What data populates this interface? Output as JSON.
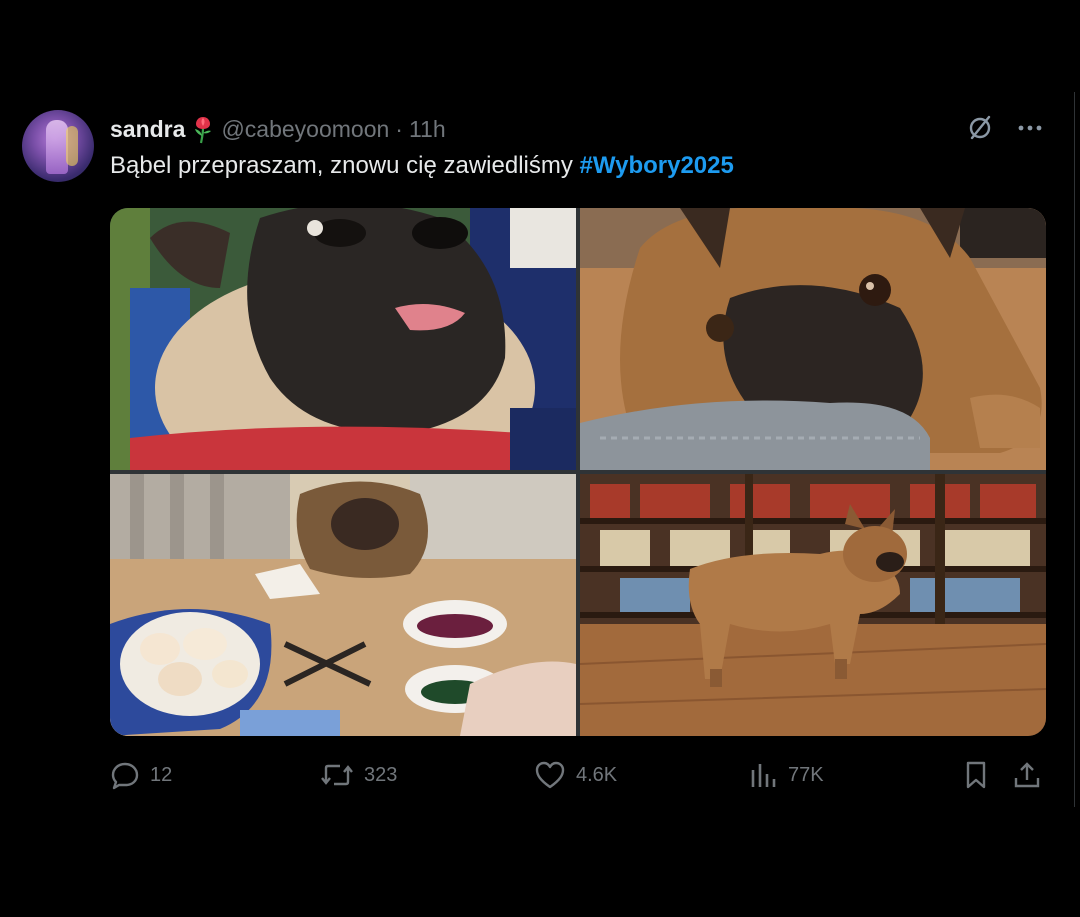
{
  "post": {
    "display_name": "sandra",
    "handle": "@cabeyoomoon",
    "separator": "·",
    "time": "11h",
    "text": "Bąbel przepraszam, znowu cię zawiedliśmy",
    "hashtag": "#Wybory2025",
    "name_emoji_icon": "rose-flower-icon",
    "media_count": 4
  },
  "top_actions": [
    "grok-icon",
    "more-icon"
  ],
  "actions": {
    "replies": "12",
    "reposts": "323",
    "likes": "4.6K",
    "views": "77K"
  },
  "colors": {
    "background": "#000000",
    "text_primary": "#e7e9ea",
    "text_secondary": "#71767b",
    "accent": "#1d9bf0"
  }
}
